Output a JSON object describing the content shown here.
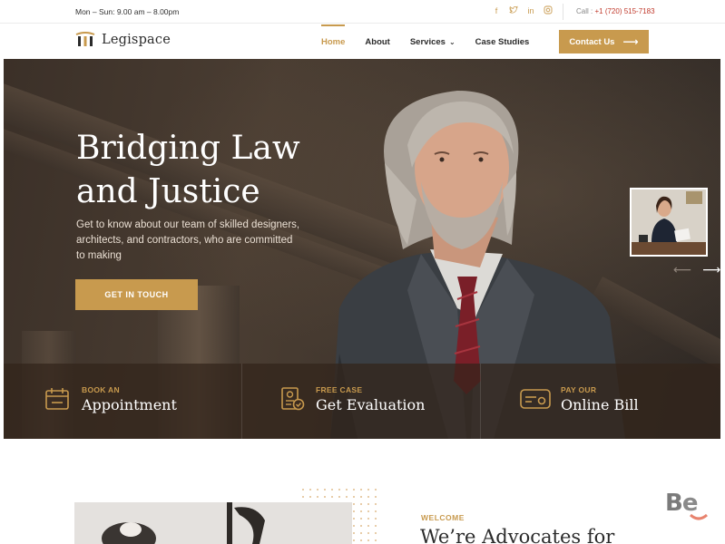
{
  "topbar": {
    "hours": "Mon – Sun: 9.00 am – 8.00pm",
    "socials": [
      "facebook-icon",
      "twitter-icon",
      "linkedin-icon",
      "instagram-icon"
    ],
    "call_label": "Call :",
    "phone": "+1 (720) 515-7183"
  },
  "nav": {
    "brand": "Legispace",
    "items": [
      {
        "label": "Home",
        "active": true
      },
      {
        "label": "About",
        "active": false
      },
      {
        "label": "Services",
        "active": false
      },
      {
        "label": "Case Studies",
        "active": false
      }
    ],
    "cta": "Contact Us"
  },
  "hero": {
    "title_line1": "Bridging Law",
    "title_line2": "and Justice",
    "description": "Get to know about our team of skilled designers, architects, and contractors, who are committed to making",
    "button": "GET IN TOUCH"
  },
  "features": [
    {
      "small": "BOOK AN",
      "big": "Appointment",
      "icon": "calendar-icon"
    },
    {
      "small": "FREE CASE",
      "big": "Get Evaluation",
      "icon": "document-check-icon"
    },
    {
      "small": "PAY OUR",
      "big": "Online Bill",
      "icon": "card-icon"
    }
  ],
  "about": {
    "eyebrow": "WELCOME",
    "heading": "We’re Advocates for"
  },
  "colors": {
    "accent": "#c89a4e",
    "text_dark": "#2b2b2b",
    "hero_overlay": "#32241a"
  }
}
